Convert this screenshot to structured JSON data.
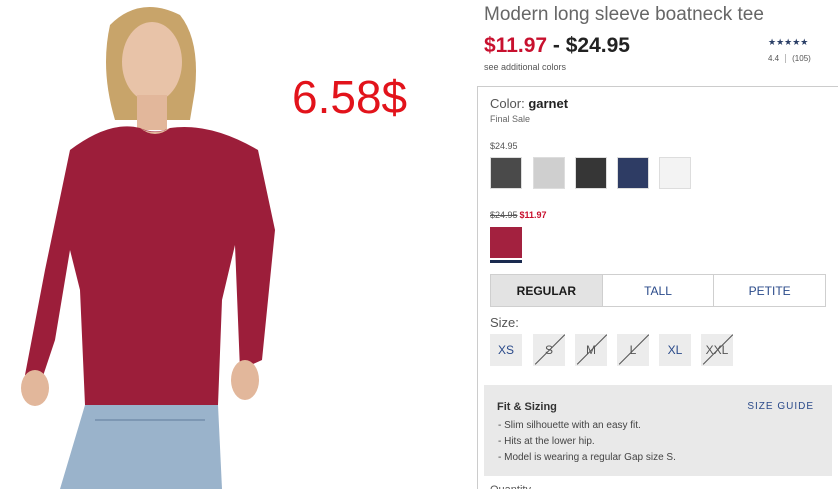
{
  "overlay_price": "6.58$",
  "product": {
    "title": "Modern long sleeve boatneck tee",
    "price_sale": "$11.97",
    "price_sep": " - ",
    "price_regular": "$24.95",
    "see_colors": "see additional colors",
    "rating": {
      "stars": "★★★★★",
      "score": "4.4",
      "count": "(105)"
    }
  },
  "color": {
    "label": "Color:",
    "selected": "garnet",
    "note": "Final Sale",
    "regular_price": "$24.95",
    "regular_swatches": [
      {
        "name": "charcoal",
        "hex": "#4a4a4a"
      },
      {
        "name": "light-gray",
        "hex": "#cfcfcf"
      },
      {
        "name": "black",
        "hex": "#363636"
      },
      {
        "name": "navy",
        "hex": "#2e3c64"
      },
      {
        "name": "white",
        "hex": "#f3f3f3"
      }
    ],
    "sale_old_price": "$24.95",
    "sale_new_price": "$11.97",
    "sale_swatch": {
      "name": "garnet",
      "hex": "#a3213f"
    }
  },
  "fit_tabs": [
    "REGULAR",
    "TALL",
    "PETITE"
  ],
  "size": {
    "label": "Size:",
    "options": [
      {
        "label": "XS",
        "available": true
      },
      {
        "label": "S",
        "available": false
      },
      {
        "label": "M",
        "available": false
      },
      {
        "label": "L",
        "available": false
      },
      {
        "label": "XL",
        "available": true
      },
      {
        "label": "XXL",
        "available": false
      }
    ]
  },
  "fit_sizing": {
    "heading": "Fit & Sizing",
    "guide_link": "SIZE GUIDE",
    "notes": [
      "- Slim silhouette with an easy fit.",
      "- Hits at the lower hip.",
      "- Model is wearing a regular Gap size S."
    ]
  },
  "quantity_label": "Quantity",
  "colors": {
    "sale": "#c8102e",
    "link": "#2a4a8a",
    "overlay": "#e2131b"
  }
}
